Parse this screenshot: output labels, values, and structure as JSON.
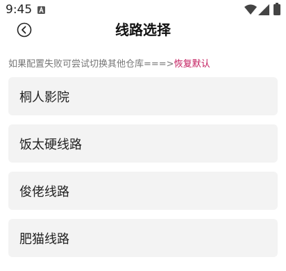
{
  "status_bar": {
    "time": "9:45",
    "icons": [
      "a-notification-icon",
      "wifi-icon",
      "cell-signal-icon",
      "battery-icon"
    ]
  },
  "header": {
    "title": "线路选择",
    "back_icon": "back-circle-icon"
  },
  "hint": {
    "text": "如果配置失败可尝试切换其他仓库===>",
    "restore_label": "恢复默认",
    "restore_color": "#c2185b"
  },
  "routes": [
    {
      "label": "桐人影院"
    },
    {
      "label": "饭太硬线路"
    },
    {
      "label": "俊佬线路"
    },
    {
      "label": "肥猫线路"
    }
  ]
}
